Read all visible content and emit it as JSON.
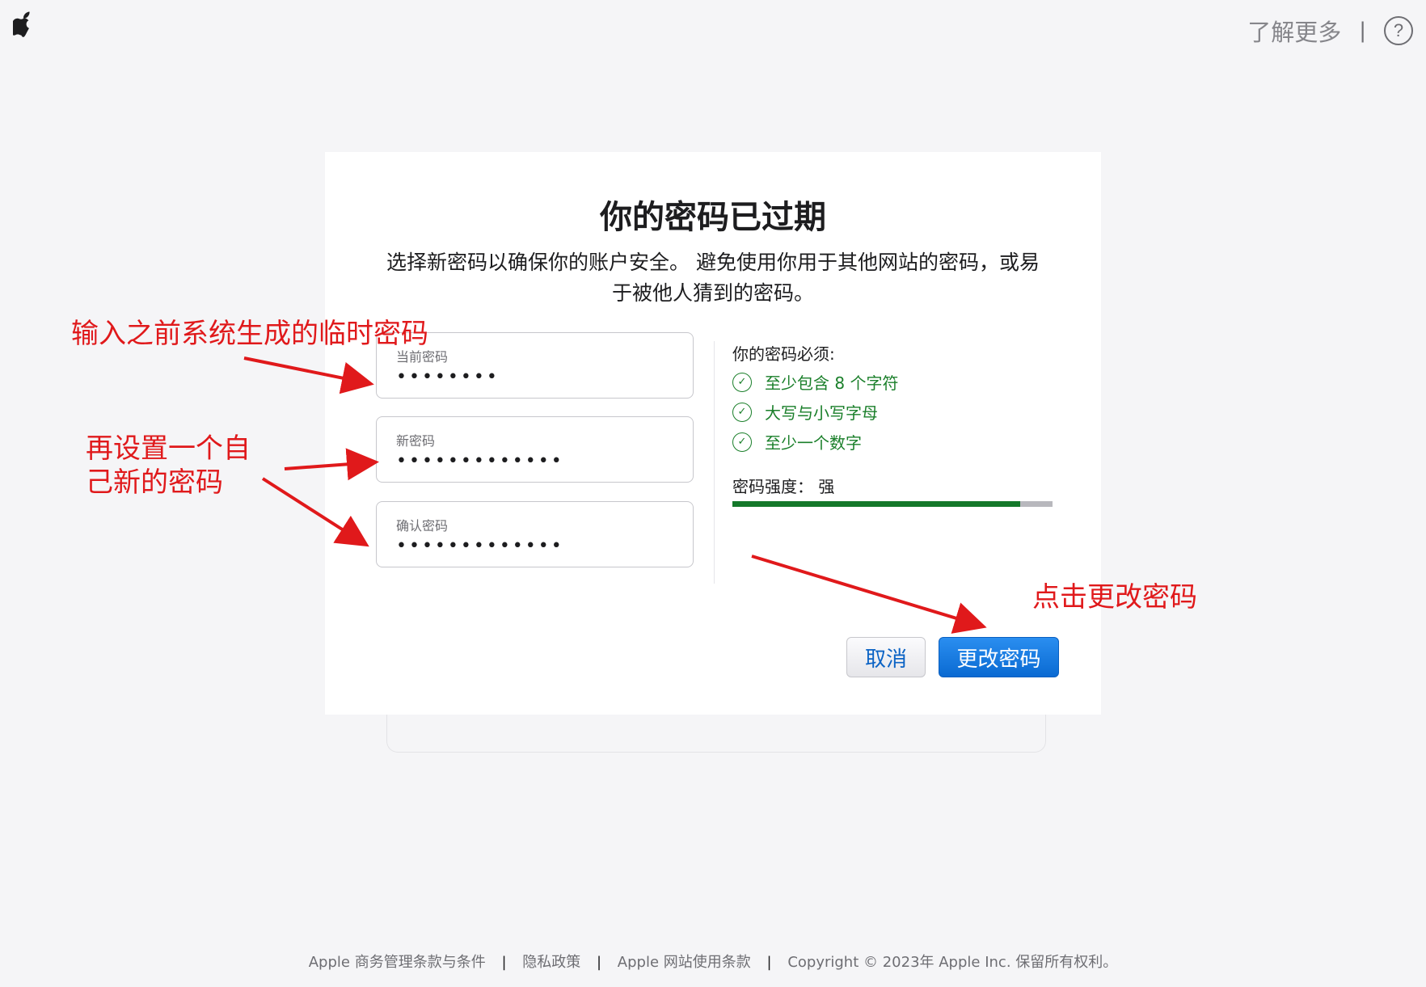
{
  "header": {
    "learn_more": "了解更多",
    "separator": "|",
    "help_icon_glyph": "?"
  },
  "dialog": {
    "title": "你的密码已过期",
    "subtitle_line1": "选择新密码以确保你的账户安全。 避免使用你用于其他网站的密码，或易",
    "subtitle_line2": "于被他人猜到的密码。",
    "fields": [
      {
        "label": "当前密码",
        "value": "••••••••"
      },
      {
        "label": "新密码",
        "value": "•••••••••••••"
      },
      {
        "label": "确认密码",
        "value": "•••••••••••••"
      }
    ],
    "requirements_title": "你的密码必须:",
    "requirements": [
      {
        "label": "至少包含 8 个字符",
        "icon": "check-circle-icon"
      },
      {
        "label": "大写与小写字母",
        "icon": "check-circle-icon"
      },
      {
        "label": "至少一个数字",
        "icon": "check-circle-icon"
      }
    ],
    "strength_label": "密码强度：  强",
    "strength_level": 0.9,
    "strength_color": "#14782a",
    "cancel_label": "取消",
    "submit_label": "更改密码"
  },
  "annotations": {
    "current": "输入之前系统生成的临时密码",
    "new_line1": "再设置一个自",
    "new_line2": "己新的密码",
    "submit": "点击更改密码",
    "color": "#e0191b"
  },
  "footer": {
    "terms": "Apple 商务管理条款与条件",
    "privacy": "隐私政策",
    "site_terms": "Apple 网站使用条款",
    "copyright": "Copyright © 2023年 Apple Inc. 保留所有权利。",
    "separator": "|"
  }
}
